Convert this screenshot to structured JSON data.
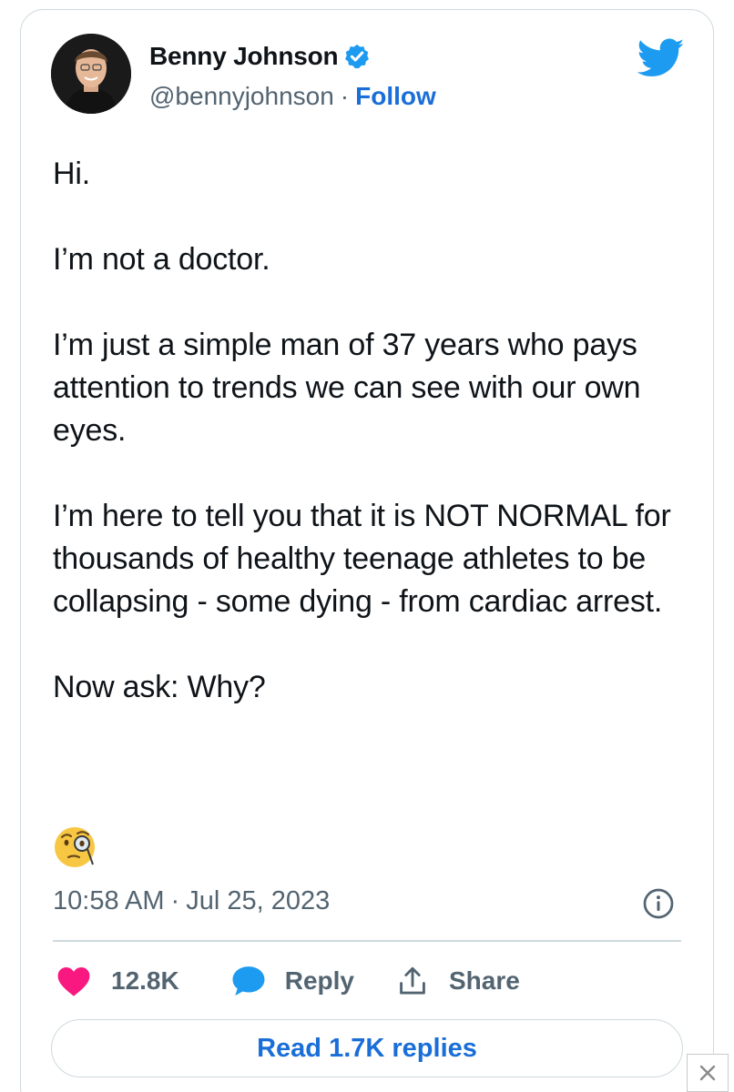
{
  "tweet": {
    "author": {
      "display_name": "Benny Johnson",
      "handle": "@bennyjohnson",
      "separator": "·",
      "follow_label": "Follow",
      "verified": true
    },
    "body": {
      "p1": "Hi.",
      "p2": "I’m not a doctor.",
      "p3": "I’m just a simple man of 37 years who pays attention to trends we can see with our own eyes.",
      "p4": "I’m here to tell you that it is NOT NORMAL for thousands of healthy teenage athletes to be collapsing - some dying - from cardiac arrest.",
      "p5": "Now ask: Why?",
      "emoji_icon": "face-with-monocle-icon"
    },
    "time": "10:58 AM",
    "date_separator": "·",
    "date": "Jul 25, 2023",
    "actions": {
      "like_count": "12.8K",
      "reply_label": "Reply",
      "share_label": "Share"
    },
    "read_replies_label": "Read 1.7K replies"
  },
  "colors": {
    "brand_blue": "#1d9bf0",
    "link_blue": "#1a6ed8",
    "heart_pink": "#f91880",
    "muted_text": "#536471",
    "border": "#cfd9de"
  },
  "icons": [
    "verified-badge-icon",
    "twitter-bird-icon",
    "face-with-monocle-icon",
    "info-icon",
    "heart-icon",
    "reply-bubble-icon",
    "share-icon",
    "close-icon"
  ]
}
